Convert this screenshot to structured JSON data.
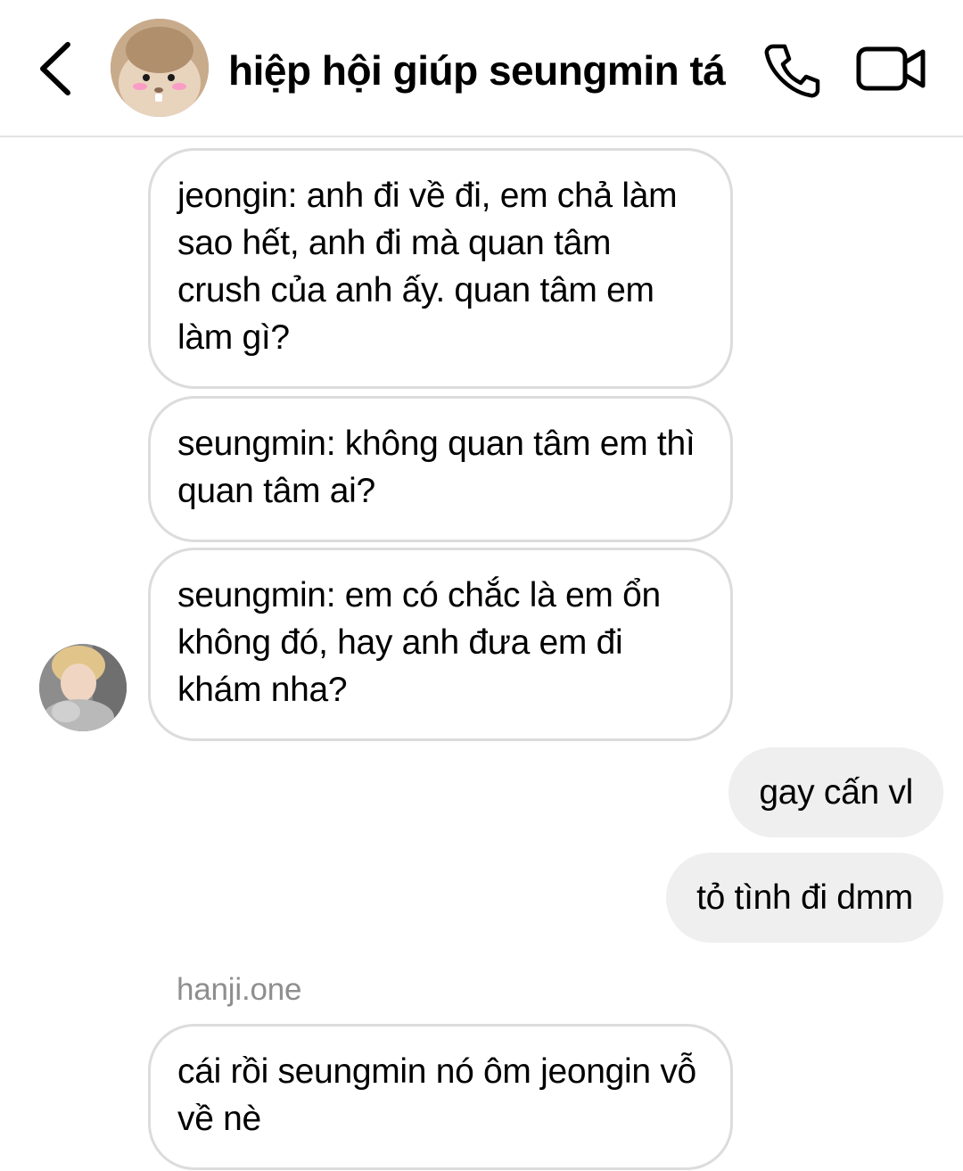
{
  "header": {
    "title": "hiệp hội giúp seungmin tá..",
    "back_icon": "chevron-left-icon",
    "call_icon": "phone-icon",
    "video_icon": "video-camera-icon"
  },
  "messages": {
    "m1": "jeongin: anh đi về đi, em chả làm sao hết, anh đi mà quan tâm crush của anh ấy. quan tâm em làm gì?",
    "m2": "seungmin: không quan tâm em thì quan tâm ai?",
    "m3": "seungmin: em có chắc là em ổn không đó, hay anh đưa em đi khám nha?",
    "m4": "gay cấn vl",
    "m5": "tỏ tình đi dmm",
    "sender_name": "hanji.one",
    "m6": "cái rồi seungmin nó ôm jeongin vỗ về nè"
  },
  "colors": {
    "incoming_border": "#dcdcdc",
    "outgoing_bg": "#efefef",
    "sender_name": "#8e8e8e",
    "divider": "#e3e3e3"
  }
}
